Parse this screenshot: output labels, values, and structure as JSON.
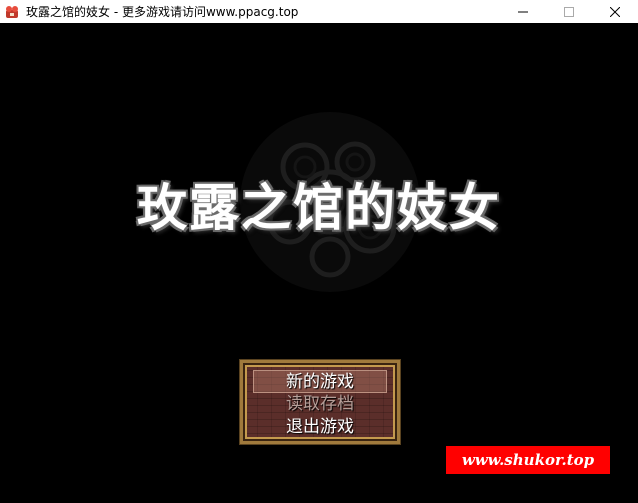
{
  "window": {
    "title": "玫露之馆的妓女 - 更多游戏请访问www.ppacg.top",
    "controls": [
      "minimize-icon",
      "maximize-icon",
      "close-icon"
    ]
  },
  "game": {
    "title": "玫露之馆的妓女",
    "menu": {
      "items": [
        {
          "label": "新的游戏",
          "state": "selected"
        },
        {
          "label": "读取存档",
          "state": "disabled"
        },
        {
          "label": "退出游戏",
          "state": "normal"
        }
      ]
    }
  },
  "watermark": {
    "text": "www.shukor.top"
  },
  "colors": {
    "background": "#000000",
    "menu_frame": "#a07a3c",
    "menu_fill": "#5b2e2a",
    "watermark_bg": "#ff0000"
  }
}
